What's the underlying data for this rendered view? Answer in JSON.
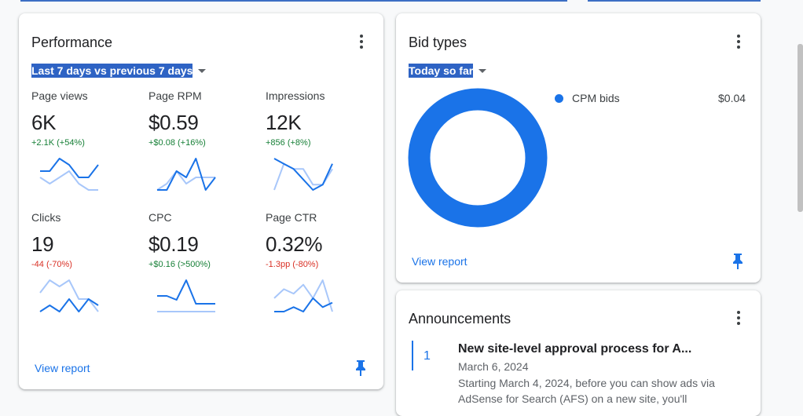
{
  "performance": {
    "title": "Performance",
    "date_range": "Last 7 days vs previous 7 days",
    "metrics": [
      {
        "label": "Page views",
        "value": "6K",
        "delta": "+2.1K (+54%)",
        "trend": "positive",
        "spark_current": [
          3,
          3,
          5,
          4,
          2,
          2,
          4
        ],
        "spark_previous": [
          2,
          1,
          2,
          3,
          1,
          0,
          0
        ]
      },
      {
        "label": "Page RPM",
        "value": "$0.59",
        "delta": "+$0.08 (+16%)",
        "trend": "positive",
        "spark_current": [
          1,
          1,
          4,
          3,
          6,
          1,
          3
        ],
        "spark_previous": [
          1,
          2,
          4,
          2,
          3,
          3,
          3
        ]
      },
      {
        "label": "Impressions",
        "value": "12K",
        "delta": "+856 (+8%)",
        "trend": "positive",
        "spark_current": [
          7,
          6,
          5,
          3,
          1,
          2,
          6
        ],
        "spark_previous": [
          1,
          6,
          5,
          5,
          2,
          2,
          5
        ]
      },
      {
        "label": "Clicks",
        "value": "19",
        "delta": "-44 (-70%)",
        "trend": "negative",
        "spark_current": [
          1,
          2,
          1,
          3,
          1,
          3,
          2
        ],
        "spark_previous": [
          4,
          6,
          5,
          6,
          3,
          3,
          1
        ]
      },
      {
        "label": "CPC",
        "value": "$0.19",
        "delta": "+$0.16 (>500%)",
        "trend": "positive",
        "spark_current": [
          4,
          4,
          3,
          8,
          2,
          2,
          2
        ],
        "spark_previous": [
          0,
          0,
          0,
          0,
          0,
          0,
          0
        ]
      },
      {
        "label": "Page CTR",
        "value": "0.32%",
        "delta": "-1.3pp (-80%)",
        "trend": "negative",
        "spark_current": [
          1,
          1,
          2,
          1,
          4,
          2,
          3
        ],
        "spark_previous": [
          4,
          6,
          5,
          7,
          4,
          8,
          1
        ]
      }
    ],
    "view_report": "View report"
  },
  "bid_types": {
    "title": "Bid types",
    "date_range": "Today so far",
    "chart_data": {
      "type": "pie",
      "categories": [
        "CPM bids"
      ],
      "values": [
        0.04
      ],
      "value_labels": [
        "$0.04"
      ],
      "colors": [
        "#1a73e8"
      ]
    },
    "view_report": "View report"
  },
  "announcements": {
    "title": "Announcements",
    "items": [
      {
        "number": "1",
        "title": "New site-level approval process for A...",
        "date": "March 6, 2024",
        "body": "Starting March 4, 2024, before you can show ads via AdSense for Search (AFS) on a new site, you'll"
      }
    ]
  },
  "colors": {
    "accent": "#1a73e8",
    "spark_current": "#1a73e8",
    "spark_previous": "#a8c7fa",
    "positive": "#188038",
    "negative": "#d93025",
    "selection": "#2e63c4"
  },
  "icons": [
    "more-vert-icon",
    "dropdown-caret-icon",
    "push-pin-icon"
  ]
}
